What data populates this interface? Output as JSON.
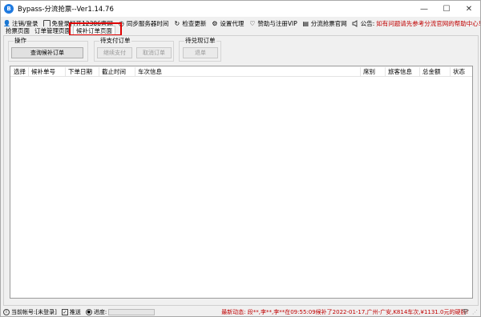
{
  "window": {
    "title": "Bypass-分流抢票--Ver1.14.76",
    "app_icon": "bypass-logo-icon",
    "controls": {
      "minimize": "—",
      "maximize": "☐",
      "close": "✕"
    }
  },
  "toolbar": {
    "items": [
      {
        "icon": "user-icon",
        "glyph": "👤",
        "label": "注销/登录"
      },
      {
        "icon": "browser-icon",
        "glyph": "▭",
        "label": "免登录打开12306官网"
      },
      {
        "icon": "clock-icon",
        "glyph": "◷",
        "label": "同步服务器时间"
      },
      {
        "icon": "refresh-icon",
        "glyph": "↻",
        "label": "检查更新"
      },
      {
        "icon": "gear-icon",
        "glyph": "⚙",
        "label": "设置代理"
      },
      {
        "icon": "heart-icon",
        "glyph": "♡",
        "label": "赞助与注册VIP"
      },
      {
        "icon": "ticket-icon",
        "glyph": "▤",
        "label": "分流抢票官网"
      }
    ],
    "notice_icon": "speaker-icon",
    "notice_label": "公告:",
    "notice_text": "如有问题请先参考分流官网的帮助中心!"
  },
  "tabs": [
    {
      "label": "抢票页面",
      "active": false
    },
    {
      "label": "订单管理页面",
      "active": false
    },
    {
      "label": "候补订单页面",
      "active": true
    }
  ],
  "groups": {
    "operation": {
      "title": "操作",
      "button": "查询候补订单"
    },
    "pending_pay": {
      "title": "待支付订单",
      "buttons": [
        "继续支付",
        "取消订单"
      ]
    },
    "pending_fulfill": {
      "title": "待兑现订单",
      "button": "退单"
    }
  },
  "table": {
    "columns": [
      "选择",
      "候补单号",
      "下单日期",
      "截止时间",
      "车次信息",
      "席别",
      "旅客信息",
      "总金额",
      "状态"
    ],
    "rows": []
  },
  "statusbar": {
    "account_icon": "info-icon",
    "account_text": "当前帐号:[未登录]",
    "push_checked": true,
    "push_label": "推送",
    "progress_icon": "progress-icon",
    "progress_label": "进度:",
    "progress": 0,
    "news": "最新动态: 段**,李**,李**在09:55:09候补了2022-01-17,广州-广安,K814车次,¥1131.0元的硬卧!",
    "wifi_icon": "wifi-icon"
  },
  "colors": {
    "accent_red": "#e00000",
    "notice_red": "#c00000",
    "progress_green": "#06b025"
  }
}
